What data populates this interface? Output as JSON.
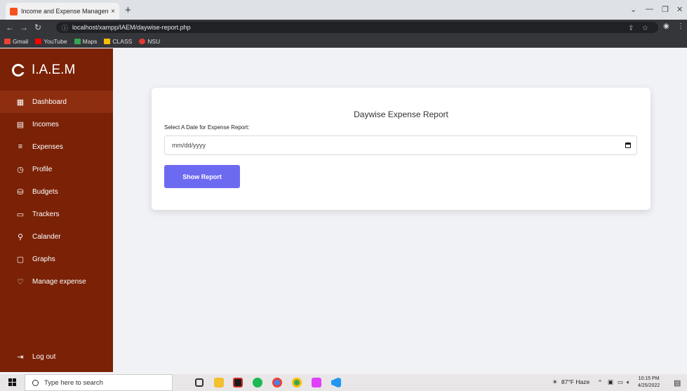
{
  "browser": {
    "tab_title": "Income and Expense Management",
    "tab_close": "×",
    "new_tab": "+",
    "url": "localhost/xampp/IAEM/daywise-report.php",
    "bookmarks": [
      {
        "label": "Gmail",
        "color": "#ea4335"
      },
      {
        "label": "YouTube",
        "color": "#ff0000"
      },
      {
        "label": "Maps",
        "color": "#34a853"
      },
      {
        "label": "CLASS",
        "color": "#fbbc05"
      },
      {
        "label": "NSU",
        "color": "#e53935"
      }
    ]
  },
  "sidebar": {
    "brand": "I.A.E.M",
    "items": [
      {
        "label": "Dashboard",
        "icon": "grid-icon",
        "active": true
      },
      {
        "label": "Incomes",
        "icon": "wallet-icon"
      },
      {
        "label": "Expenses",
        "icon": "list-icon"
      },
      {
        "label": "Profile",
        "icon": "clock-icon"
      },
      {
        "label": "Budgets",
        "icon": "database-icon"
      },
      {
        "label": "Trackers",
        "icon": "monitor-icon"
      },
      {
        "label": "Calander",
        "icon": "user-icon"
      },
      {
        "label": "Graphs",
        "icon": "chat-icon"
      },
      {
        "label": "Manage expense",
        "icon": "heart-icon"
      }
    ],
    "logout": "Log out"
  },
  "report": {
    "title": "Daywise Expense Report",
    "field_label": "Select A Date for Expense Report:",
    "date_placeholder": "mm/dd/yyyy",
    "button_label": "Show Report"
  },
  "taskbar": {
    "search_placeholder": "Type here to search",
    "weather": "87°F  Haze",
    "time": "10:15 PM",
    "date": "4/25/2022"
  },
  "colors": {
    "sidebar_bg": "#7a2106",
    "sidebar_active": "#8e2e10",
    "button_bg": "#6d6af2",
    "page_bg": "#f1f2f6"
  }
}
